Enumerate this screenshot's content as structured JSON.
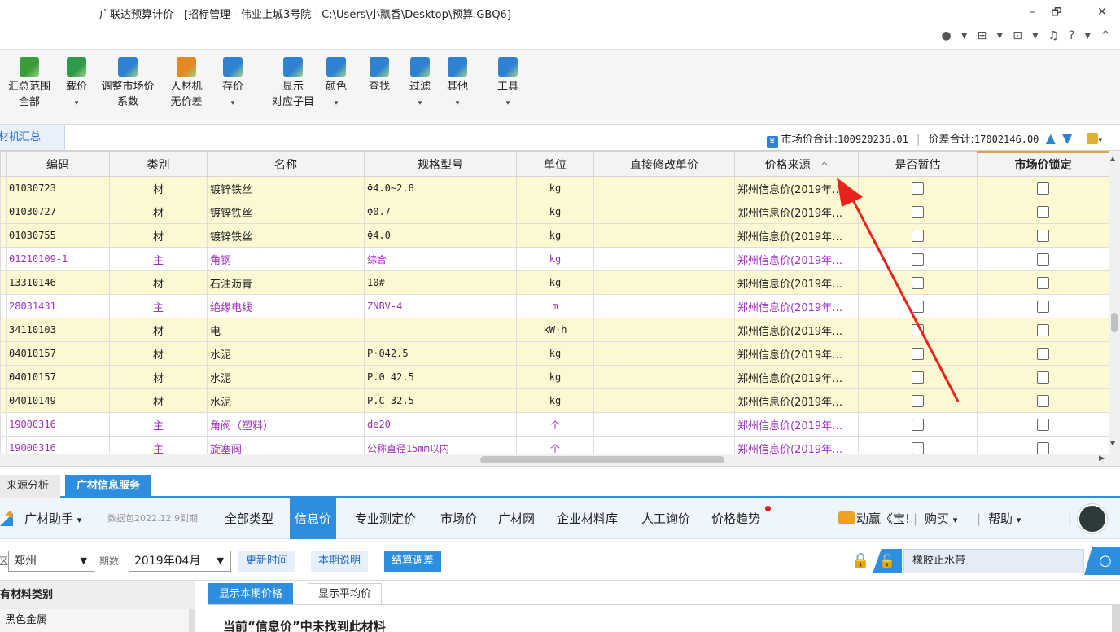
{
  "window": {
    "title": "广联达预算计价 - [招标管理 - 伟业上城3号院 - C:\\Users\\小飘香\\Desktop\\预算.GBQ6]",
    "minimize": "–",
    "restore": "🗗",
    "close": "✕",
    "top_icons": "● ▾ ⊞ ▾ ⊡ ▾ ♫ ? ▾ ^"
  },
  "ribbon": {
    "items": [
      {
        "label": "汇总范围",
        "sub": "全部",
        "icon": "sum-range-icon",
        "color": "#3a9d3a"
      },
      {
        "label": "载价",
        "sub": "▾",
        "icon": "load-price-icon",
        "color": "#2f9a4a"
      },
      {
        "label": "调整市场价",
        "sub": "系数",
        "icon": "adjust-price-icon",
        "color": "#2e82d0"
      },
      {
        "label": "人材机",
        "sub": "无价差",
        "icon": "scale-icon",
        "color": "#e08a20"
      },
      {
        "label": "存价",
        "sub": "▾",
        "icon": "save-price-icon",
        "color": "#2e82d0"
      },
      {
        "label": "显示",
        "sub": "对应子目",
        "icon": "show-sub-icon",
        "color": "#2e82d0"
      },
      {
        "label": "颜色",
        "sub": "▾",
        "icon": "paint-bucket-icon",
        "color": "#2e82d0"
      },
      {
        "label": "查找",
        "sub": "",
        "icon": "binoculars-icon",
        "color": "#2e82d0"
      },
      {
        "label": "过滤",
        "sub": "▾",
        "icon": "filter-icon",
        "color": "#2e82d0"
      },
      {
        "label": "其他",
        "sub": "▾",
        "icon": "grid-icon",
        "color": "#2e82d0"
      },
      {
        "label": "工具",
        "sub": "▾",
        "icon": "tools-icon",
        "color": "#2e82d0"
      }
    ]
  },
  "tabbar": {
    "tab_label": "材机汇总",
    "market_total_label": "市场价合计:",
    "market_total": "100920236.01",
    "sep": "|",
    "diff_total_label": "价差合计:",
    "diff_total": "17002146.00"
  },
  "table": {
    "headers": [
      "编码",
      "类别",
      "名称",
      "规格型号",
      "单位",
      "直接修改单价",
      "价格来源",
      "是否暂估",
      "市场价锁定"
    ],
    "sort_indicator": "^",
    "rows": [
      {
        "type": "cai",
        "code": "01030723",
        "cat": "材",
        "name": "镀锌铁丝",
        "spec": "Φ4.0~2.8",
        "unit": "kg",
        "price": "",
        "source": "郑州信息价(2019年…"
      },
      {
        "type": "cai",
        "code": "01030727",
        "cat": "材",
        "name": "镀锌铁丝",
        "spec": "Φ0.7",
        "unit": "kg",
        "price": "",
        "source": "郑州信息价(2019年…"
      },
      {
        "type": "cai",
        "code": "01030755",
        "cat": "材",
        "name": "镀锌铁丝",
        "spec": "Φ4.0",
        "unit": "kg",
        "price": "",
        "source": "郑州信息价(2019年…"
      },
      {
        "type": "zhu",
        "code": "01210109-1",
        "cat": "主",
        "name": "角钢",
        "spec": "综合",
        "unit": "kg",
        "price": "",
        "source": "郑州信息价(2019年…"
      },
      {
        "type": "cai",
        "code": "13310146",
        "cat": "材",
        "name": "石油沥青",
        "spec": "10#",
        "unit": "kg",
        "price": "",
        "source": "郑州信息价(2019年…"
      },
      {
        "type": "zhu",
        "code": "28031431",
        "cat": "主",
        "name": "绝缘电线",
        "spec": "ZNBV-4",
        "unit": "m",
        "price": "",
        "source": "郑州信息价(2019年…"
      },
      {
        "type": "cai",
        "code": "34110103",
        "cat": "材",
        "name": "电",
        "spec": "",
        "unit": "kW·h",
        "price": "",
        "source": "郑州信息价(2019年…"
      },
      {
        "type": "cai",
        "code": "04010157",
        "cat": "材",
        "name": "水泥",
        "spec": "P·042.5",
        "unit": "kg",
        "price": "",
        "source": "郑州信息价(2019年…"
      },
      {
        "type": "cai",
        "code": "04010157",
        "cat": "材",
        "name": "水泥",
        "spec": "P.0 42.5",
        "unit": "kg",
        "price": "",
        "source": "郑州信息价(2019年…"
      },
      {
        "type": "cai",
        "code": "04010149",
        "cat": "材",
        "name": "水泥",
        "spec": "P.C 32.5",
        "unit": "kg",
        "price": "",
        "source": "郑州信息价(2019年…"
      },
      {
        "type": "zhu",
        "code": "19000316",
        "cat": "主",
        "name": "角阀（塑料）",
        "spec": "de20",
        "unit": "个",
        "price": "",
        "source": "郑州信息价(2019年…"
      },
      {
        "type": "zhu",
        "code": "19000316",
        "cat": "主",
        "name": "旋塞阀",
        "spec": "公称直径15mm以内",
        "unit": "个",
        "price": "",
        "source": "郑州信息价(2019年…"
      }
    ]
  },
  "bottom": {
    "tab_source": "来源分析",
    "tab_info": "广材信息服务",
    "assistant": "广材助手",
    "assistant_caret": "▾",
    "data_pkg": "数据包2022.12.9到期",
    "nav": [
      "全部类型",
      "信息价",
      "专业测定价",
      "市场价",
      "广材网",
      "企业材料库",
      "人工询价",
      "价格趋势"
    ],
    "promo": "动赢《宝!",
    "buy": "购买",
    "help": "帮助",
    "bar_sep": "|",
    "region_label": "区",
    "region": "郑州",
    "period_label": "期数",
    "period": "2019年04月",
    "btn_update": "更新时间",
    "btn_desc": "本期说明",
    "btn_settle": "结算调差",
    "search_value": "橡胶止水带",
    "category_head": "有材料类别",
    "category_item": "黑色金属",
    "subtab_current": "显示本期价格",
    "subtab_avg": "显示平均价",
    "not_found": "当前“信息价”中未找到此材料"
  },
  "colors": {
    "accent": "#2d8ee0",
    "cai_row": "#fbf8d2",
    "zhu_text": "#a030c0",
    "arrow": "#e8231c"
  }
}
